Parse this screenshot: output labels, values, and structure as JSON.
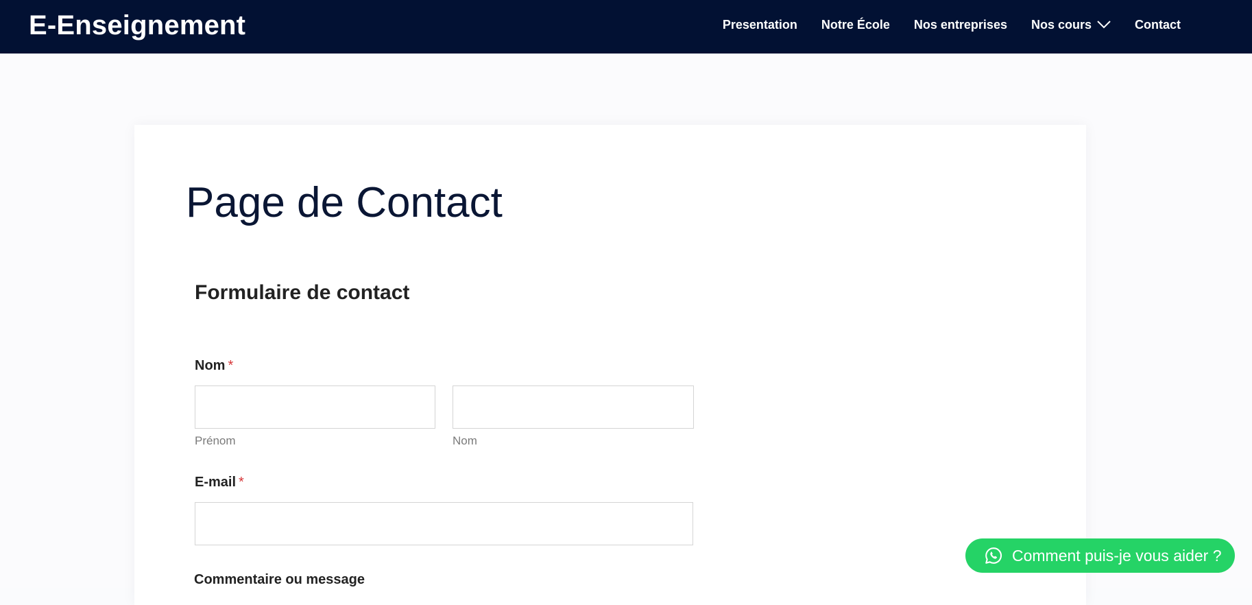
{
  "header": {
    "logo": "E-Enseignement",
    "nav": [
      {
        "label": "Presentation"
      },
      {
        "label": "Notre École"
      },
      {
        "label": "Nos entreprises"
      },
      {
        "label": "Nos cours",
        "has_dropdown": true
      },
      {
        "label": "Contact"
      }
    ]
  },
  "page": {
    "title": "Page de Contact",
    "form_title": "Formulaire de contact"
  },
  "form": {
    "name_label": "Nom",
    "required_marker": "*",
    "first_name_value": "",
    "first_name_sublabel": "Prénom",
    "last_name_value": "",
    "last_name_sublabel": "Nom",
    "email_label": "E-mail",
    "email_value": "",
    "comment_label": "Commentaire ou message"
  },
  "whatsapp": {
    "label": "Comment puis-je vous aider ?",
    "icon": "whatsapp-icon"
  },
  "colors": {
    "header_bg": "#021133",
    "title": "#0a1634",
    "required": "#d63638",
    "whatsapp": "#25d366"
  }
}
